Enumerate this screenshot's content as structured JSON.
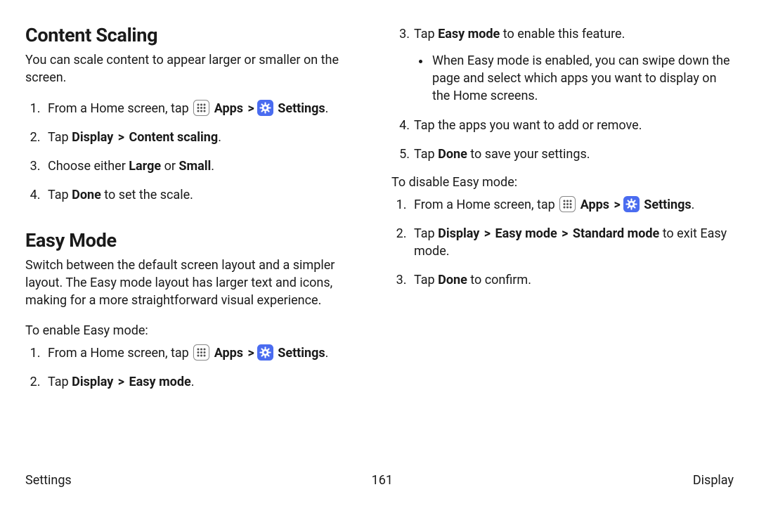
{
  "headings": {
    "content_scaling": "Content Scaling",
    "easy_mode": "Easy Mode"
  },
  "content_scaling": {
    "intro": "You can scale content to appear larger or smaller on the screen.",
    "steps": {
      "s1_pre": "From a Home screen, tap ",
      "s1_apps": "Apps",
      "s1_settings": "Settings",
      "s2_pre": "Tap ",
      "s2_display": "Display",
      "s2_content_scaling": "Content scaling",
      "s3_pre": "Choose either ",
      "s3_large": "Large",
      "s3_or": " or ",
      "s3_small": "Small",
      "s4_pre": "Tap ",
      "s4_done": "Done",
      "s4_post": " to set the scale."
    }
  },
  "easy_mode": {
    "intro": "Switch between the default screen layout and a simpler layout. The Easy mode layout has larger text and icons, making for a more straightforward visual experience.",
    "enable_label": "To enable Easy mode:",
    "enable_steps": {
      "s1_pre": "From a Home screen, tap ",
      "s1_apps": "Apps",
      "s1_settings": "Settings",
      "s2_pre": "Tap ",
      "s2_display": "Display",
      "s2_easy_mode": "Easy mode",
      "s3_pre": "Tap ",
      "s3_easy_mode": "Easy mode",
      "s3_post": " to enable this feature.",
      "s3_bullet": "When Easy mode is enabled, you can swipe down the page and select which apps you want to display on the Home screens.",
      "s4": "Tap the apps you want to add or remove.",
      "s5_pre": "Tap ",
      "s5_done": "Done",
      "s5_post": " to save your settings."
    },
    "disable_label": "To disable Easy mode:",
    "disable_steps": {
      "s1_pre": "From a Home screen, tap ",
      "s1_apps": "Apps",
      "s1_settings": "Settings",
      "s2_pre": "Tap ",
      "s2_display": "Display",
      "s2_easy_mode": "Easy mode",
      "s2_standard_mode": "Standard mode",
      "s2_post": " to exit Easy mode.",
      "s3_pre": "Tap ",
      "s3_done": "Done",
      "s3_post": " to confirm."
    }
  },
  "footer": {
    "left": "Settings",
    "center": "161",
    "right": "Display"
  },
  "glyph": {
    "chevron": ">",
    "period": "."
  }
}
